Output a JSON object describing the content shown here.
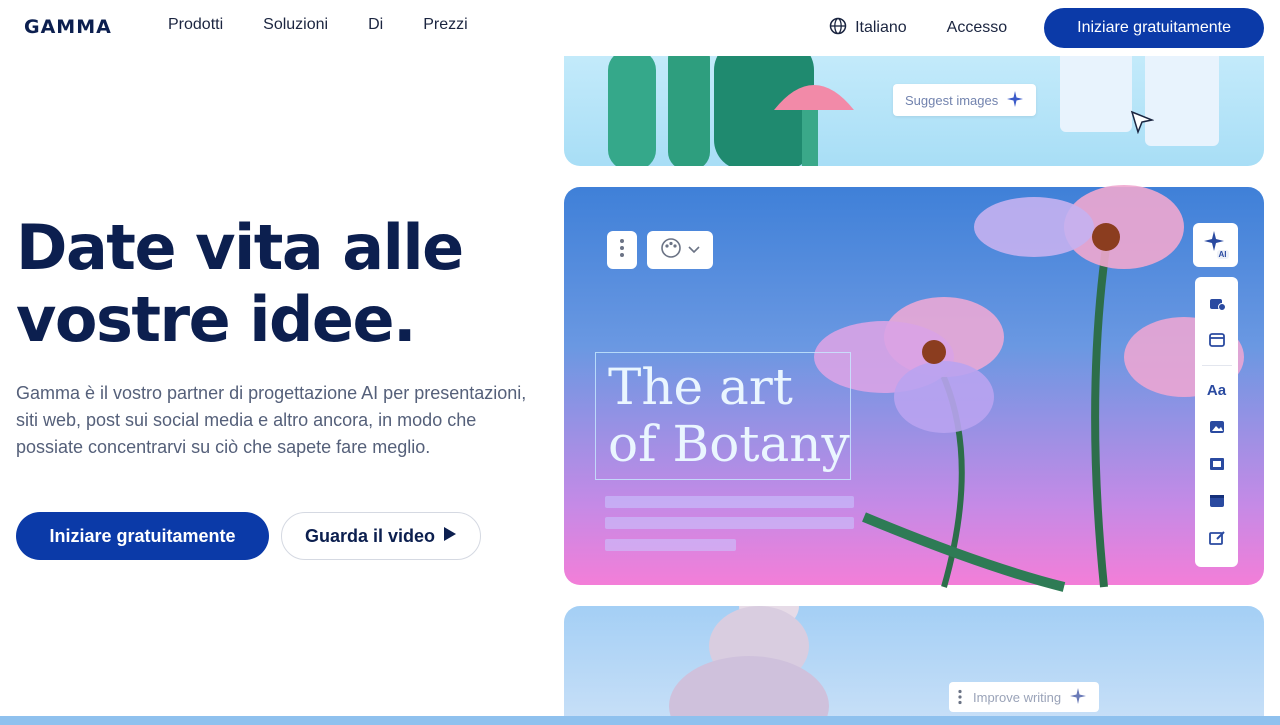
{
  "nav": {
    "logo": "GAMMA",
    "links": [
      "Prodotti",
      "Soluzioni",
      "Di",
      "Prezzi"
    ],
    "language": "Italiano",
    "login": "Accesso",
    "cta": "Iniziare gratuitamente"
  },
  "hero": {
    "title_line1": "Date vita alle",
    "title_line2": "vostre idee.",
    "subtitle": "Gamma è il vostro partner di progettazione AI per presentazioni, siti web, post sui social media e altro ancora, in modo che possiate concentrarvi su ciò che sapete fare meglio.",
    "primary_cta": "Iniziare gratuitamente",
    "secondary_cta": "Guarda il video"
  },
  "preview": {
    "suggest_images": "Suggest images",
    "slide_title_line1": "The art",
    "slide_title_line2": "of Botany",
    "ai_badge": "AI",
    "text_tool": "Aa",
    "improve_writing": "Improve writing"
  },
  "colors": {
    "brand_blue": "#0b3aa8",
    "heading": "#0c1f4f"
  }
}
